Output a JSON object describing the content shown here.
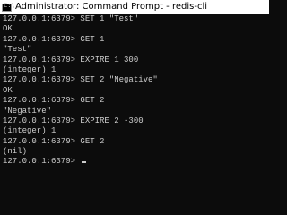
{
  "window": {
    "title": "Administrator: Command Prompt - redis-cli",
    "icon": "command-prompt-icon",
    "icon_glyph": "C:\\"
  },
  "colors": {
    "console_background": "#0c0c0c",
    "console_text": "#cccccc",
    "titlebar_background": "#ffffff",
    "titlebar_text": "#000000"
  },
  "console": {
    "lines": [
      "127.0.0.1:6379> SET 1 \"Test\"",
      "OK",
      "127.0.0.1:6379> GET 1",
      "\"Test\"",
      "127.0.0.1:6379> EXPIRE 1 300",
      "(integer) 1",
      "127.0.0.1:6379> SET 2 \"Negative\"",
      "OK",
      "127.0.0.1:6379> GET 2",
      "\"Negative\"",
      "127.0.0.1:6379> EXPIRE 2 -300",
      "(integer) 1",
      "127.0.0.1:6379> GET 2",
      "(nil)"
    ],
    "prompt": "127.0.0.1:6379> "
  }
}
